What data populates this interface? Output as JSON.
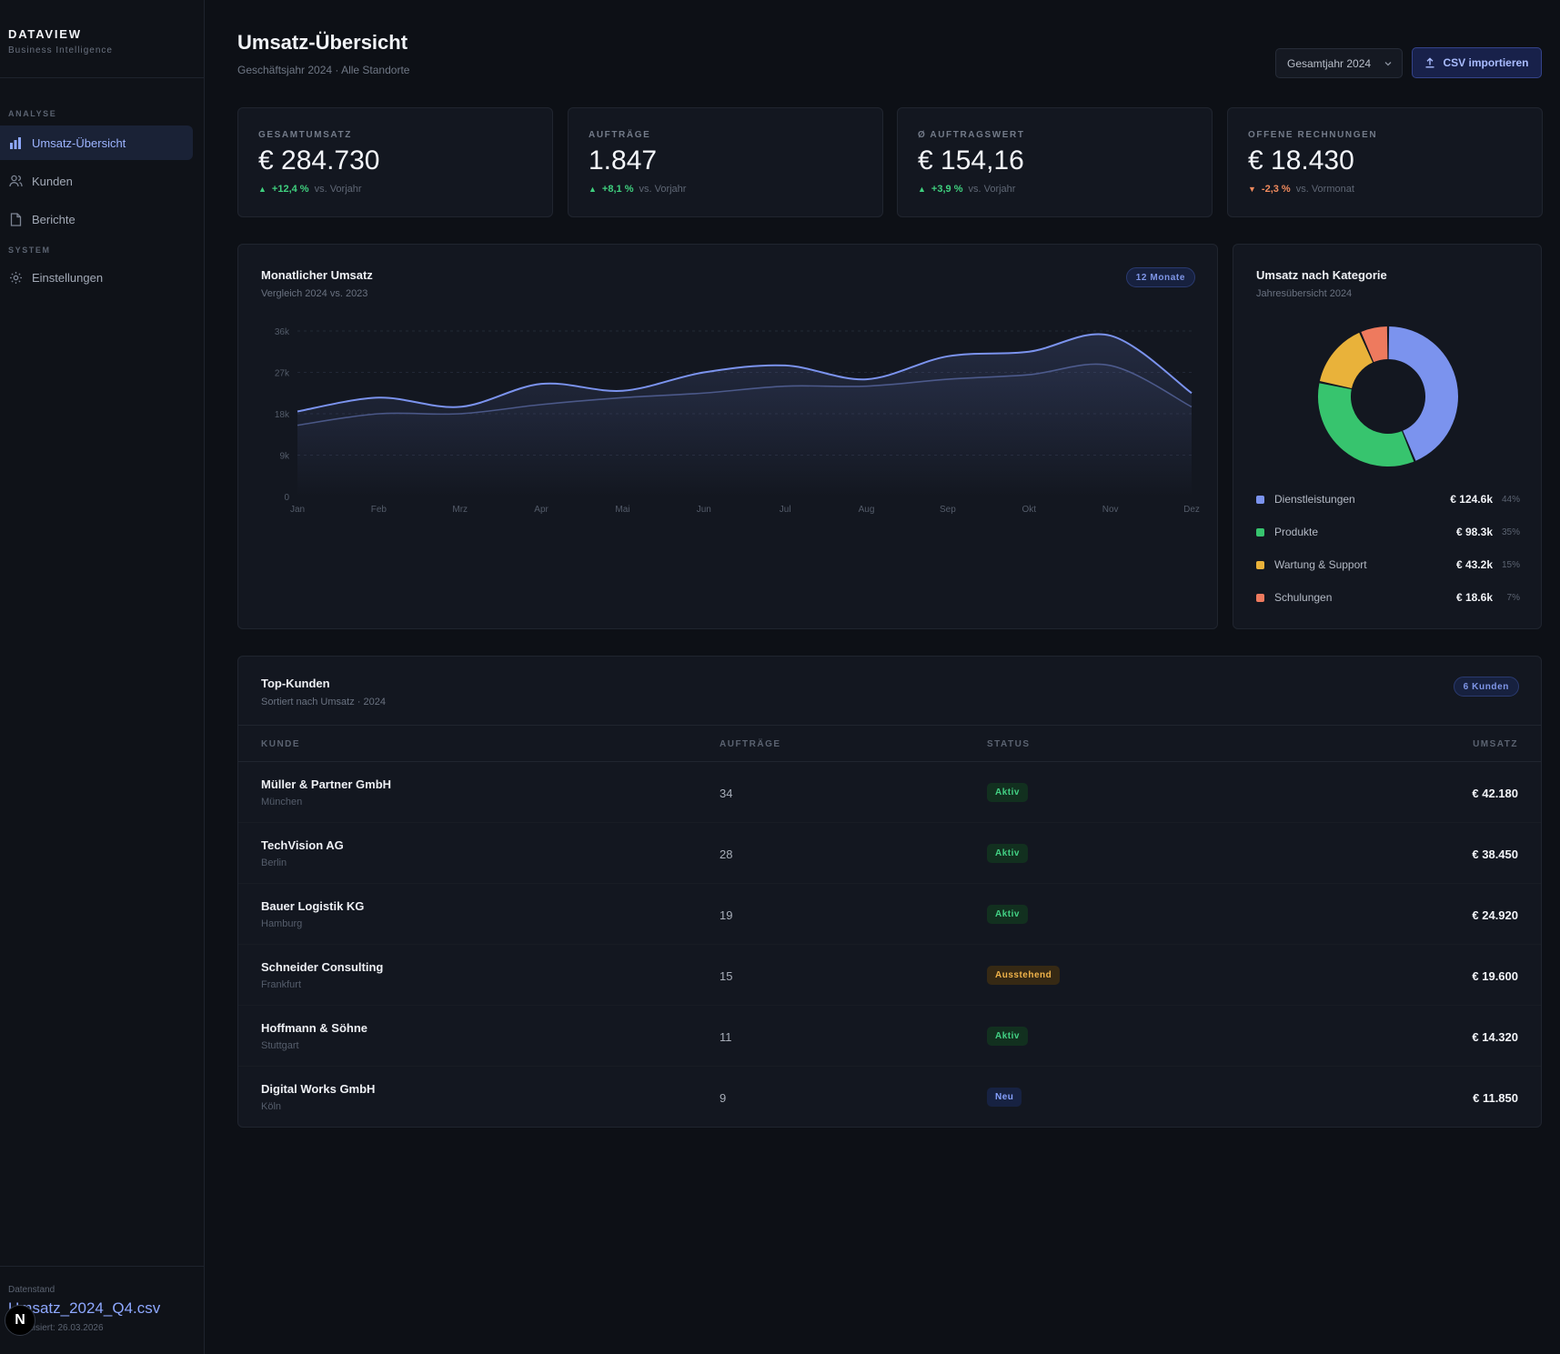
{
  "brand": {
    "title": "DATAVIEW",
    "subtitle": "Business Intelligence"
  },
  "sidebar": {
    "sections": [
      {
        "label": "ANALYSE",
        "items": [
          {
            "label": "Umsatz-Übersicht",
            "icon": "bar-chart-icon",
            "active": true
          },
          {
            "label": "Kunden",
            "icon": "users-icon"
          },
          {
            "label": "Berichte",
            "icon": "document-icon"
          }
        ]
      },
      {
        "label": "SYSTEM",
        "items": [
          {
            "label": "Einstellungen",
            "icon": "gear-icon"
          }
        ]
      }
    ],
    "footer": {
      "label": "Datenstand",
      "file": "Umsatz_2024_Q4.csv",
      "updated": "Aktualisiert: 26.03.2026"
    }
  },
  "header": {
    "title": "Umsatz-Übersicht",
    "subtitle": "Geschäftsjahr 2024 · Alle Standorte",
    "period_select": "Gesamtjahr 2024",
    "import_button": "CSV importieren"
  },
  "kpis": [
    {
      "label": "GESAMTUMSATZ",
      "value": "€ 284.730",
      "delta": "+12,4 %",
      "trend": "up",
      "compare": "vs. Vorjahr"
    },
    {
      "label": "AUFTRÄGE",
      "value": "1.847",
      "delta": "+8,1 %",
      "trend": "up",
      "compare": "vs. Vorjahr"
    },
    {
      "label": "Ø AUFTRAGSWERT",
      "value": "€ 154,16",
      "delta": "+3,9 %",
      "trend": "up",
      "compare": "vs. Vorjahr"
    },
    {
      "label": "OFFENE RECHNUNGEN",
      "value": "€ 18.430",
      "delta": "-2,3 %",
      "trend": "down",
      "compare": "vs. Vormonat"
    }
  ],
  "revenue_chart": {
    "title": "Monatlicher Umsatz",
    "subtitle": "Vergleich 2024 vs. 2023",
    "badge": "12 Monate"
  },
  "category_chart": {
    "title": "Umsatz nach Kategorie",
    "subtitle": "Jahresübersicht 2024",
    "legend": [
      {
        "name": "Dienstleistungen",
        "value": "€ 124.6k",
        "pct": "44%"
      },
      {
        "name": "Produkte",
        "value": "€ 98.3k",
        "pct": "35%"
      },
      {
        "name": "Wartung & Support",
        "value": "€ 43.2k",
        "pct": "15%"
      },
      {
        "name": "Schulungen",
        "value": "€ 18.6k",
        "pct": "7%"
      }
    ]
  },
  "chart_data": [
    {
      "type": "area",
      "title": "Monatlicher Umsatz",
      "subtitle": "Vergleich 2024 vs. 2023",
      "categories": [
        "Jan",
        "Feb",
        "Mrz",
        "Apr",
        "Mai",
        "Jun",
        "Jul",
        "Aug",
        "Sep",
        "Okt",
        "Nov",
        "Dez"
      ],
      "yticks": [
        "36k",
        "27k",
        "18k",
        "9k",
        "0"
      ],
      "ylim": [
        0,
        36000
      ],
      "grid": true,
      "series": [
        {
          "values": [
            18500,
            21500,
            19500,
            24500,
            23000,
            27000,
            28500,
            25500,
            30500,
            31500,
            35000,
            22500
          ],
          "color": "#7b93ee"
        },
        {
          "values": [
            15500,
            18000,
            18000,
            20000,
            21500,
            22500,
            24000,
            24000,
            25500,
            26500,
            28500,
            19500
          ],
          "color": "#46527e"
        }
      ]
    },
    {
      "type": "pie",
      "title": "Umsatz nach Kategorie",
      "subtitle": "Jahresübersicht 2024",
      "categories": [
        "Dienstleistungen",
        "Produkte",
        "Wartung & Support",
        "Schulungen"
      ],
      "values": [
        124.6,
        98.3,
        43.2,
        18.6
      ],
      "colors": [
        "#7b93ee",
        "#37c46e",
        "#e9b23a",
        "#ee7a5e"
      ]
    }
  ],
  "customers": {
    "title": "Top-Kunden",
    "subtitle": "Sortiert nach Umsatz · 2024",
    "badge": "6 Kunden",
    "columns": {
      "customer": "KUNDE",
      "orders": "AUFTRÄGE",
      "status": "STATUS",
      "revenue": "UMSATZ"
    },
    "rows": [
      {
        "name": "Müller & Partner GmbH",
        "city": "München",
        "orders": "34",
        "status": "Aktiv",
        "status_type": "aktiv",
        "revenue": "€ 42.180"
      },
      {
        "name": "TechVision AG",
        "city": "Berlin",
        "orders": "28",
        "status": "Aktiv",
        "status_type": "aktiv",
        "revenue": "€ 38.450"
      },
      {
        "name": "Bauer Logistik KG",
        "city": "Hamburg",
        "orders": "19",
        "status": "Aktiv",
        "status_type": "aktiv",
        "revenue": "€ 24.920"
      },
      {
        "name": "Schneider Consulting",
        "city": "Frankfurt",
        "orders": "15",
        "status": "Ausstehend",
        "status_type": "ausstehend",
        "revenue": "€ 19.600"
      },
      {
        "name": "Hoffmann & Söhne",
        "city": "Stuttgart",
        "orders": "11",
        "status": "Aktiv",
        "status_type": "aktiv",
        "revenue": "€ 14.320"
      },
      {
        "name": "Digital Works GmbH",
        "city": "Köln",
        "orders": "9",
        "status": "Neu",
        "status_type": "neu",
        "revenue": "€ 11.850"
      }
    ]
  },
  "overlay_badge": "N"
}
